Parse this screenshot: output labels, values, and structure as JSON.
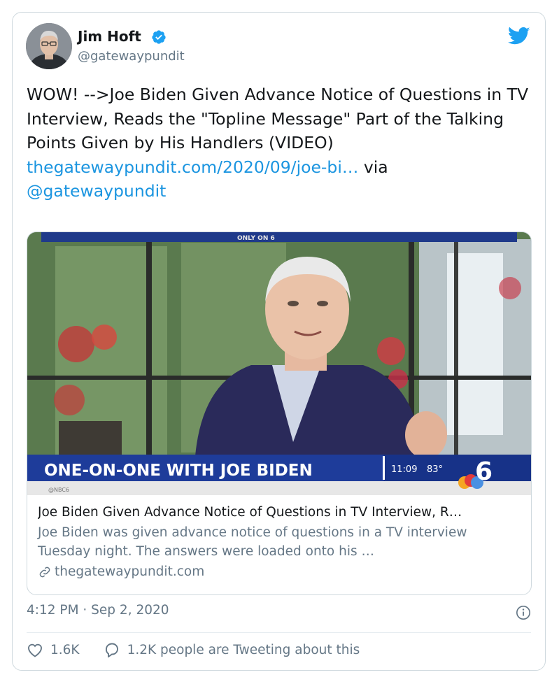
{
  "author": {
    "name": "Jim Hoft",
    "handle": "@gatewaypundit",
    "verified": true
  },
  "tweet": {
    "text": "WOW! -->Joe Biden Given Advance Notice of Questions in TV Interview, Reads the \"Topline Message\" Part of the Talking Points Given by His Handlers (VIDEO)",
    "link_text": "thegatewaypundit.com/2020/09/joe-bi…",
    "via_label": "via",
    "via_mention": "@gatewaypundit"
  },
  "media": {
    "banner_top": "ONLY ON 6",
    "lower_third": "ONE-ON-ONE WITH JOE BIDEN",
    "clock": "11:09",
    "temperature": "83°",
    "social_handle": "@NBC6"
  },
  "link_card": {
    "title": "Joe Biden Given Advance Notice of Questions in TV Interview, R…",
    "description": "Joe Biden was given advance notice of questions in a TV interview Tuesday night. The answers were loaded onto his …",
    "domain": "thegatewaypundit.com"
  },
  "timestamp": "4:12 PM · Sep 2, 2020",
  "stats": {
    "likes": "1.6K",
    "conversation": "1.2K people are Tweeting about this"
  },
  "icons": [
    "verified-badge-icon",
    "twitter-bird-icon",
    "link-icon",
    "info-icon",
    "heart-icon",
    "comment-icon"
  ],
  "colors": {
    "link": "#1b95e0",
    "twitter_blue": "#1da1f2",
    "secondary_text": "#657786",
    "border": "#cfd9de"
  }
}
